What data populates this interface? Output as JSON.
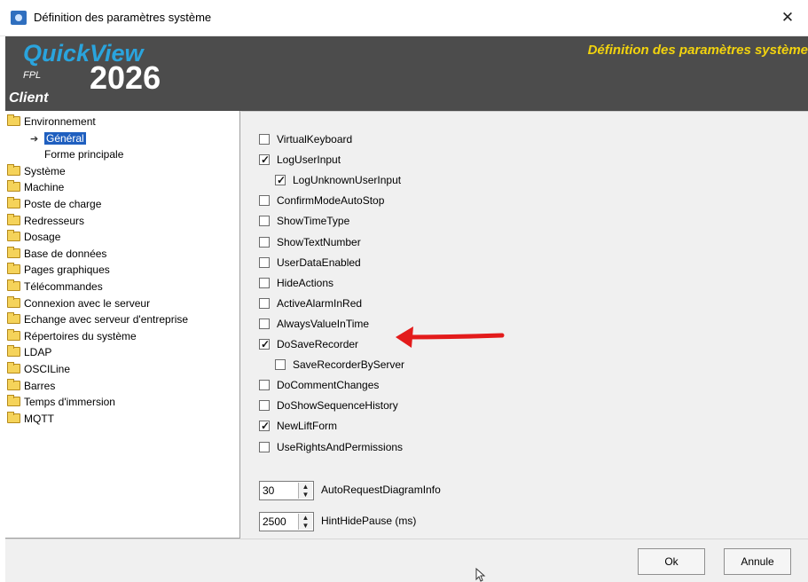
{
  "window": {
    "title": "Définition des paramètres système",
    "close_glyph": "✕"
  },
  "header": {
    "logo_quickview": "QuickView",
    "logo_year": "2026",
    "logo_fpl": "FPL",
    "logo_client": "Client",
    "title": "Définition des paramètres système",
    "title_color": "#f2d30e",
    "brand_color": "#2aa4dd"
  },
  "tree": {
    "root": "Environnement",
    "children": [
      "Général",
      "Forme principale"
    ],
    "selected": "Général",
    "items": [
      "Système",
      "Machine",
      "Poste de charge",
      "Redresseurs",
      "Dosage",
      "Base de données",
      "Pages graphiques",
      "Télécommandes",
      "Connexion avec le serveur",
      "Echange avec serveur d'entreprise",
      "Répertoires du système",
      "LDAP",
      "OSCILine",
      "Barres",
      "Temps d'immersion",
      "MQTT"
    ]
  },
  "settings": {
    "checkboxes": [
      {
        "label": "VirtualKeyboard",
        "checked": false
      },
      {
        "label": "LogUserInput",
        "checked": true
      },
      {
        "label": "LogUnknownUserInput",
        "checked": true,
        "indent": true
      },
      {
        "label": "ConfirmModeAutoStop",
        "checked": false
      },
      {
        "label": "ShowTimeType",
        "checked": false
      },
      {
        "label": "ShowTextNumber",
        "checked": false
      },
      {
        "label": "UserDataEnabled",
        "checked": false
      },
      {
        "label": "HideActions",
        "checked": false
      },
      {
        "label": "ActiveAlarmInRed",
        "checked": false
      },
      {
        "label": "AlwaysValueInTime",
        "checked": false
      },
      {
        "label": "DoSaveRecorder",
        "checked": true
      },
      {
        "label": "SaveRecorderByServer",
        "checked": false,
        "indent": true
      },
      {
        "label": "DoCommentChanges",
        "checked": false
      },
      {
        "label": "DoShowSequenceHistory",
        "checked": false
      },
      {
        "label": "NewLiftForm",
        "checked": true
      },
      {
        "label": "UseRightsAndPermissions",
        "checked": false
      }
    ],
    "spinners": [
      {
        "value": "30",
        "label": "AutoRequestDiagramInfo"
      },
      {
        "value": "2500",
        "label": "HintHidePause (ms)"
      }
    ]
  },
  "footer": {
    "ok_label": "Ok",
    "cancel_label": "Annule"
  },
  "annotation": {
    "arrow_color": "#e31b1b"
  }
}
